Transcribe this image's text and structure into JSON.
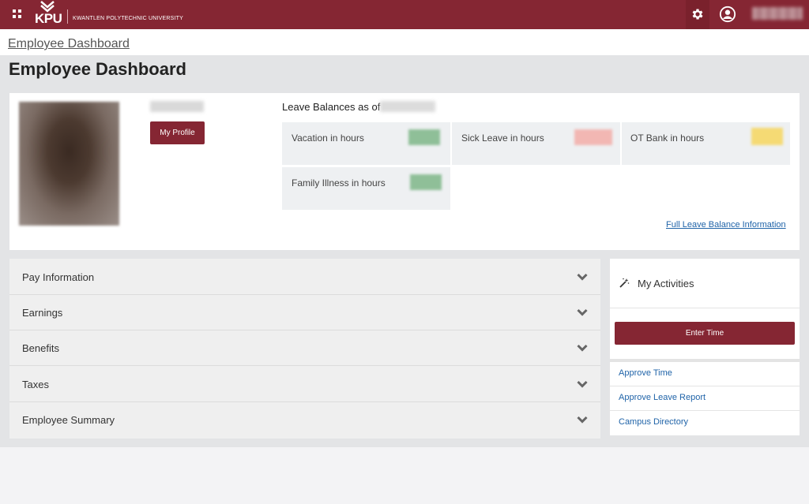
{
  "header": {
    "logo_text": "KPU",
    "university_name": "KWANTLEN POLYTECHNIC UNIVERSITY",
    "brand_color": "#852633",
    "icons": [
      "apps-grid-icon",
      "gear-icon",
      "user-icon"
    ]
  },
  "breadcrumb": "Employee Dashboard",
  "page_title": "Employee Dashboard",
  "profile": {
    "my_profile_label": "My Profile"
  },
  "leave": {
    "title": "Leave Balances as of",
    "items": [
      {
        "label": "Vacation in hours",
        "color": "#8fbf98"
      },
      {
        "label": "Sick Leave in hours",
        "color": "#f2b7b3"
      },
      {
        "label": "OT Bank in hours",
        "color": "#f5da74"
      },
      {
        "label": "Family Illness in hours",
        "color": "#8fbf98"
      }
    ],
    "full_link": "Full Leave Balance Information"
  },
  "accordion": [
    {
      "label": "Pay Information"
    },
    {
      "label": "Earnings"
    },
    {
      "label": "Benefits"
    },
    {
      "label": "Taxes"
    },
    {
      "label": "Employee Summary"
    }
  ],
  "activities": {
    "title": "My Activities",
    "enter_time_label": "Enter Time",
    "links": [
      {
        "label": "Approve Time"
      },
      {
        "label": "Approve Leave Report"
      },
      {
        "label": "Campus Directory"
      }
    ]
  }
}
